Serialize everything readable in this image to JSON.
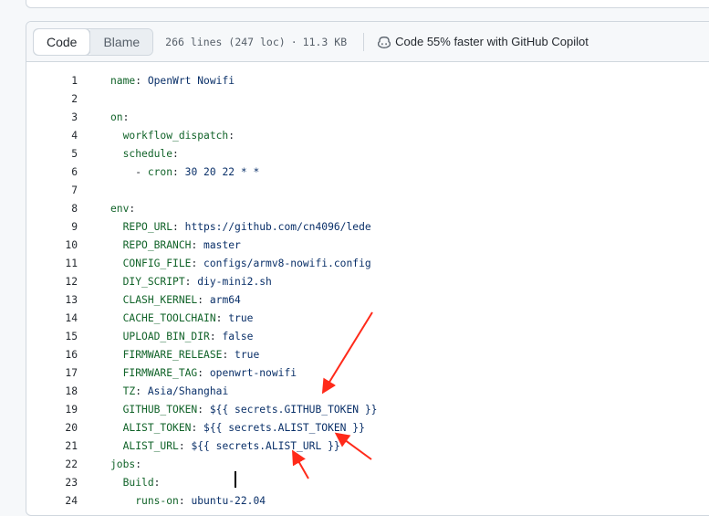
{
  "header": {
    "code_label": "Code",
    "blame_label": "Blame",
    "lines_info": "266 lines (247 loc)",
    "separator": "·",
    "size_info": "11.3 KB",
    "copilot_label": "Code 55% faster with GitHub Copilot"
  },
  "lines": [
    {
      "n": "1",
      "indent": "",
      "key": "name",
      "sep": ": ",
      "val": "OpenWrt Nowifi"
    },
    {
      "n": "2",
      "indent": "",
      "key": "",
      "sep": "",
      "val": ""
    },
    {
      "n": "3",
      "indent": "",
      "key": "on",
      "sep": ":",
      "val": ""
    },
    {
      "n": "4",
      "indent": "  ",
      "key": "workflow_dispatch",
      "sep": ":",
      "val": ""
    },
    {
      "n": "5",
      "indent": "  ",
      "key": "schedule",
      "sep": ":",
      "val": ""
    },
    {
      "n": "6",
      "indent": "    - ",
      "key": "cron",
      "sep": ": ",
      "val": "30 20 22 * *"
    },
    {
      "n": "7",
      "indent": "",
      "key": "",
      "sep": "",
      "val": ""
    },
    {
      "n": "8",
      "indent": "",
      "key": "env",
      "sep": ":",
      "val": ""
    },
    {
      "n": "9",
      "indent": "  ",
      "key": "REPO_URL",
      "sep": ": ",
      "val": "https://github.com/cn4096/lede"
    },
    {
      "n": "10",
      "indent": "  ",
      "key": "REPO_BRANCH",
      "sep": ": ",
      "val": "master"
    },
    {
      "n": "11",
      "indent": "  ",
      "key": "CONFIG_FILE",
      "sep": ": ",
      "val": "configs/armv8-nowifi.config"
    },
    {
      "n": "12",
      "indent": "  ",
      "key": "DIY_SCRIPT",
      "sep": ": ",
      "val": "diy-mini2.sh"
    },
    {
      "n": "13",
      "indent": "  ",
      "key": "CLASH_KERNEL",
      "sep": ": ",
      "val": "arm64"
    },
    {
      "n": "14",
      "indent": "  ",
      "key": "CACHE_TOOLCHAIN",
      "sep": ": ",
      "val": "true"
    },
    {
      "n": "15",
      "indent": "  ",
      "key": "UPLOAD_BIN_DIR",
      "sep": ": ",
      "val": "false"
    },
    {
      "n": "16",
      "indent": "  ",
      "key": "FIRMWARE_RELEASE",
      "sep": ": ",
      "val": "true"
    },
    {
      "n": "17",
      "indent": "  ",
      "key": "FIRMWARE_TAG",
      "sep": ": ",
      "val": "openwrt-nowifi"
    },
    {
      "n": "18",
      "indent": "  ",
      "key": "TZ",
      "sep": ": ",
      "val": "Asia/Shanghai"
    },
    {
      "n": "19",
      "indent": "  ",
      "key": "GITHUB_TOKEN",
      "sep": ": ",
      "val": "${{ secrets.GITHUB_TOKEN }}"
    },
    {
      "n": "20",
      "indent": "  ",
      "key": "ALIST_TOKEN",
      "sep": ": ",
      "val": "${{ secrets.ALIST_TOKEN }}"
    },
    {
      "n": "21",
      "indent": "  ",
      "key": "ALIST_URL",
      "sep": ": ",
      "val": "${{ secrets.ALIST_URL }}"
    },
    {
      "n": "22",
      "indent": "",
      "key": "jobs",
      "sep": ":",
      "val": ""
    },
    {
      "n": "23",
      "indent": "  ",
      "key": "Build",
      "sep": ":",
      "val": ""
    },
    {
      "n": "24",
      "indent": "    ",
      "key": "runs-on",
      "sep": ": ",
      "val": "ubuntu-22.04"
    }
  ],
  "colors": {
    "key": "#116329",
    "value": "#0a3069",
    "annotation_arrow": "#ff2a1a"
  },
  "icons": {
    "copilot": "copilot-icon"
  }
}
